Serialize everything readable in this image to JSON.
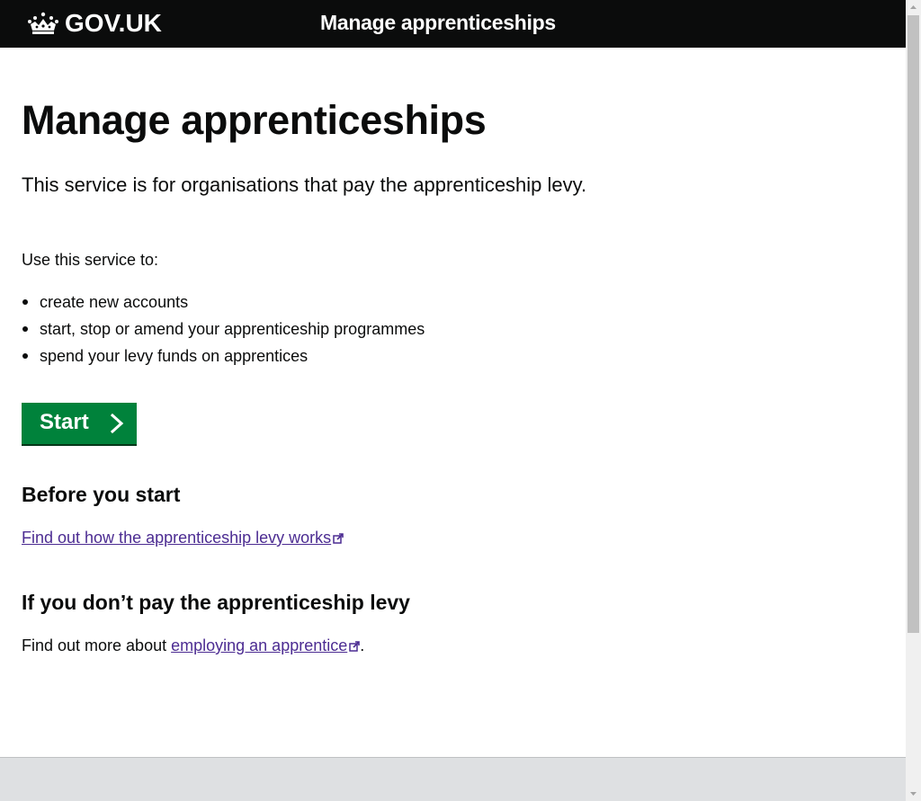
{
  "header": {
    "logo_text": "GOV.UK",
    "logo_icon": "crown-icon",
    "service_name": "Manage apprenticeships"
  },
  "main": {
    "title": "Manage apprenticeships",
    "lede": "This service is for organisations that pay the apprenticeship levy.",
    "intro": "Use this service to:",
    "bullets": [
      "create new accounts",
      "start, stop or amend your apprenticeship programmes",
      "spend your levy funds on apprentices"
    ],
    "start_button": "Start",
    "before_heading": "Before you start",
    "levy_link": "Find out how the apprenticeship levy works",
    "not_pay_heading": "If you don’t pay the apprenticeship levy",
    "more_prefix": "Find out more about ",
    "employ_link": "employing an apprentice",
    "more_suffix": "."
  },
  "colors": {
    "header_bg": "#0b0c0c",
    "button_green": "#00823b",
    "link": "#4c2c92",
    "footer_bg": "#dee0e2"
  }
}
